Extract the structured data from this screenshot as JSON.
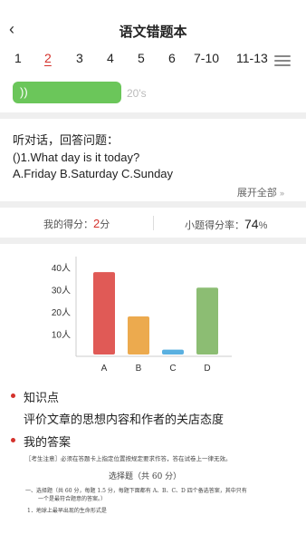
{
  "header": {
    "back_icon": "back-chevron-icon",
    "title": "语文错题本"
  },
  "tabs": {
    "items": [
      "1",
      "2",
      "3",
      "4",
      "5",
      "6",
      "7-10",
      "11-13"
    ],
    "active_index": 1,
    "menu_icon": "hamburger-menu-icon"
  },
  "audio": {
    "icon": "speaker-wave-icon",
    "duration": "20's",
    "color": "#6bc65a"
  },
  "question": {
    "intro": "听对话，回答问题：",
    "text": "()1.What day is it today?",
    "options": "A.Friday B.Saturday C.Sunday",
    "expand_label": "展开全部",
    "expand_icon": "double-chevron-down-icon"
  },
  "scores": {
    "my_score_label": "我的得分：",
    "my_score_value": "2",
    "my_score_unit": "分",
    "rate_label": "小题得分率：",
    "rate_value": "74",
    "rate_unit": "%"
  },
  "chart_data": {
    "type": "bar",
    "categories": [
      "A",
      "B",
      "C",
      "D"
    ],
    "values": [
      38,
      18,
      3,
      31
    ],
    "y_ticks": [
      "10人",
      "20人",
      "30人",
      "40人"
    ],
    "ylim": [
      0,
      45
    ],
    "colors": [
      "#e05a56",
      "#ecaa4e",
      "#5ab0e0",
      "#8cbd73"
    ]
  },
  "knowledge": {
    "title": "知识点",
    "text": "评价文章的思想内容和作者的关店态度"
  },
  "answer": {
    "title": "我的答案",
    "paper_lines": [
      "［考生注意］必须在答题卡上指定位置按规定要求作答，答在试卷上一律无效。",
      "选择题（共 60 分）",
      "一、选择题（共 60 分，每题 1.5 分，每题下面都有 A、B、C、D 四个备选答案，其中只有",
      "一个是最符合题意的答案。）",
      "1．地球上最早出现的生命形式是"
    ]
  },
  "accent_color": "#d4322c"
}
